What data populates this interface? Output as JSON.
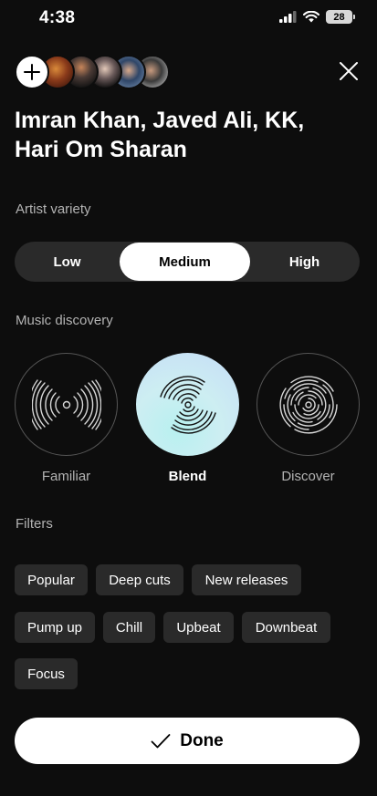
{
  "status_bar": {
    "time": "4:38",
    "battery": "28"
  },
  "header": {
    "avatars": [
      "avatar-1",
      "avatar-2",
      "avatar-3",
      "avatar-4",
      "avatar-5"
    ]
  },
  "title": "Imran Khan, Javed Ali, KK, Hari Om Sharan",
  "artist_variety": {
    "label": "Artist variety",
    "options": [
      "Low",
      "Medium",
      "High"
    ],
    "selected": "Medium"
  },
  "music_discovery": {
    "label": "Music discovery",
    "options": [
      {
        "label": "Familiar",
        "icon": "familiar-icon"
      },
      {
        "label": "Blend",
        "icon": "blend-icon"
      },
      {
        "label": "Discover",
        "icon": "discover-icon"
      }
    ],
    "selected": "Blend"
  },
  "filters": {
    "label": "Filters",
    "chips": [
      "Popular",
      "Deep cuts",
      "New releases",
      "Pump up",
      "Chill",
      "Upbeat",
      "Downbeat",
      "Focus"
    ]
  },
  "done_button": {
    "label": "Done"
  },
  "colors": {
    "background": "#0d0d0d",
    "chip": "#2a2a2a",
    "accent_gradient": "#c5e9f3"
  }
}
